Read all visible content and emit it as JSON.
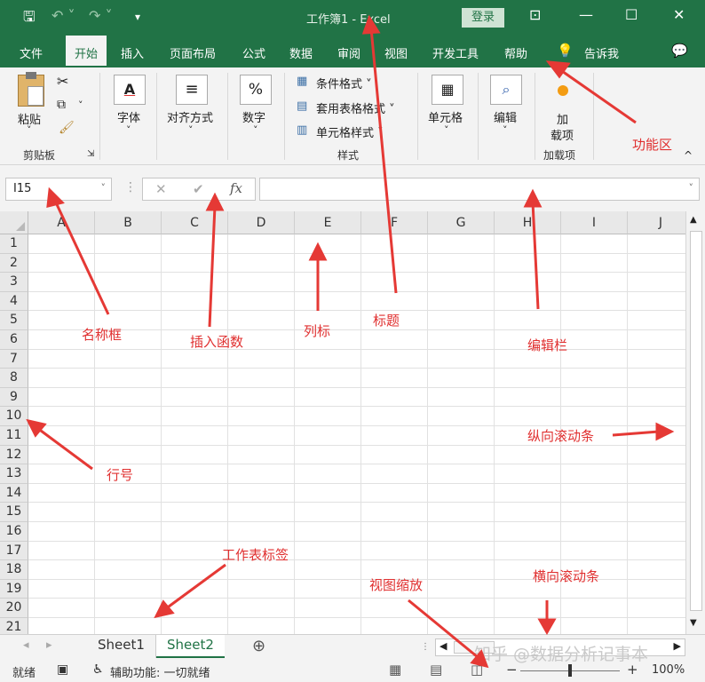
{
  "titlebar": {
    "title": "工作簿1  -  Excel",
    "login": "登录",
    "qa_save": "🖫",
    "qa_undo": "↶ ˅",
    "qa_redo": "↷ ˅",
    "qa_more": "▾",
    "btn_ribbon_opts": "⊡",
    "btn_min": "—",
    "btn_max": "☐",
    "btn_close": "✕"
  },
  "menu": {
    "tabs": [
      "文件",
      "开始",
      "插入",
      "页面布局",
      "公式",
      "数据",
      "审阅",
      "视图",
      "开发工具",
      "帮助"
    ],
    "tellme": "告诉我",
    "tellme_icon": "lightbulb-icon",
    "share": "💬"
  },
  "ribbon": {
    "paste": "粘贴",
    "clipboard_group": "剪贴板",
    "font": "字体",
    "align": "对齐方式",
    "number": "数字",
    "cond_format": "条件格式 ˅",
    "table_format": "套用表格格式 ˅",
    "cell_style": "单元格样式 ˅",
    "style_group": "样式",
    "cells": "单元格",
    "edit": "编辑",
    "addin_1": "加",
    "addin_2": "载项",
    "addin_group": "加载项",
    "collapse": "^",
    "dropdown": "˅"
  },
  "formula": {
    "namebox": "I15",
    "fx": "fx",
    "cancel": "✕",
    "confirm": "✔",
    "colon": "⋮",
    "dropdown": "˅"
  },
  "grid": {
    "columns": [
      "A",
      "B",
      "C",
      "D",
      "E",
      "F",
      "G",
      "H",
      "I",
      "J"
    ],
    "rows": [
      "1",
      "2",
      "3",
      "4",
      "5",
      "6",
      "7",
      "8",
      "9",
      "10",
      "11",
      "12",
      "13",
      "14",
      "15",
      "16",
      "17",
      "18",
      "19",
      "20",
      "21"
    ]
  },
  "sheets": {
    "tabs": [
      "Sheet1",
      "Sheet2"
    ],
    "active": "Sheet2",
    "add": "⊕",
    "nav_prev": "◂",
    "nav_next": "▸"
  },
  "status": {
    "ready": "就绪",
    "accessibility": "辅助功能: 一切就绪",
    "zoom": "100%",
    "zoom_minus": "−",
    "zoom_plus": "+"
  },
  "annotations": {
    "ribbon": "功能区",
    "namebox": "名称框",
    "insert_fn": "插入函数",
    "col_label": "列标",
    "title": "标题",
    "formula_bar": "编辑栏",
    "vscroll": "纵向滚动条",
    "row_num": "行号",
    "sheet_tab": "工作表标签",
    "view_zoom": "视图缩放",
    "hscroll": "横向滚动条"
  },
  "watermark": "知乎 @数据分析记事本",
  "colors": {
    "excel_green": "#217346",
    "annotation_red": "#e03030"
  }
}
